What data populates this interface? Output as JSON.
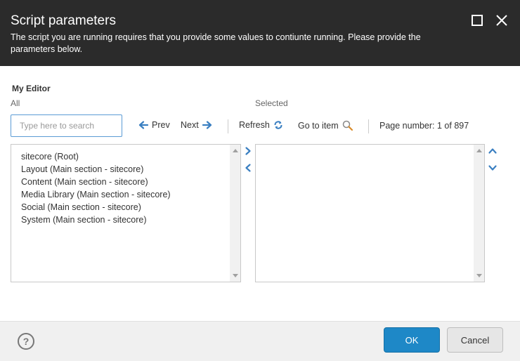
{
  "dialog": {
    "title": "Script parameters",
    "subtitle": "The script you are running requires that you provide some values to contiunte running. Please provide the parameters below.",
    "header_color": "#2b2b2b"
  },
  "editor": {
    "label": "My Editor",
    "all_label": "All",
    "selected_label": "Selected",
    "search_placeholder": "Type here to search",
    "prev_label": "Prev",
    "next_label": "Next",
    "refresh_label": "Refresh",
    "goto_label": "Go to item",
    "page_number": "Page number: 1 of 897",
    "all_items": [
      "sitecore (Root)",
      "Layout (Main section - sitecore)",
      "Content (Main section - sitecore)",
      "Media Library (Main section - sitecore)",
      "Social (Main section - sitecore)",
      "System (Main section - sitecore)"
    ],
    "selected_items": []
  },
  "footer": {
    "help_glyph": "?",
    "ok_label": "OK",
    "cancel_label": "Cancel",
    "accent_color": "#1e88c7"
  },
  "icons": {
    "maximize": "maximize-icon",
    "close": "close-icon",
    "prev": "arrow-left-icon",
    "next": "arrow-right-icon",
    "refresh": "refresh-icon",
    "search": "magnifier-icon",
    "add": "chevron-right-icon",
    "remove": "chevron-left-icon",
    "move_up": "chevron-up-icon",
    "move_down": "chevron-down-icon"
  }
}
